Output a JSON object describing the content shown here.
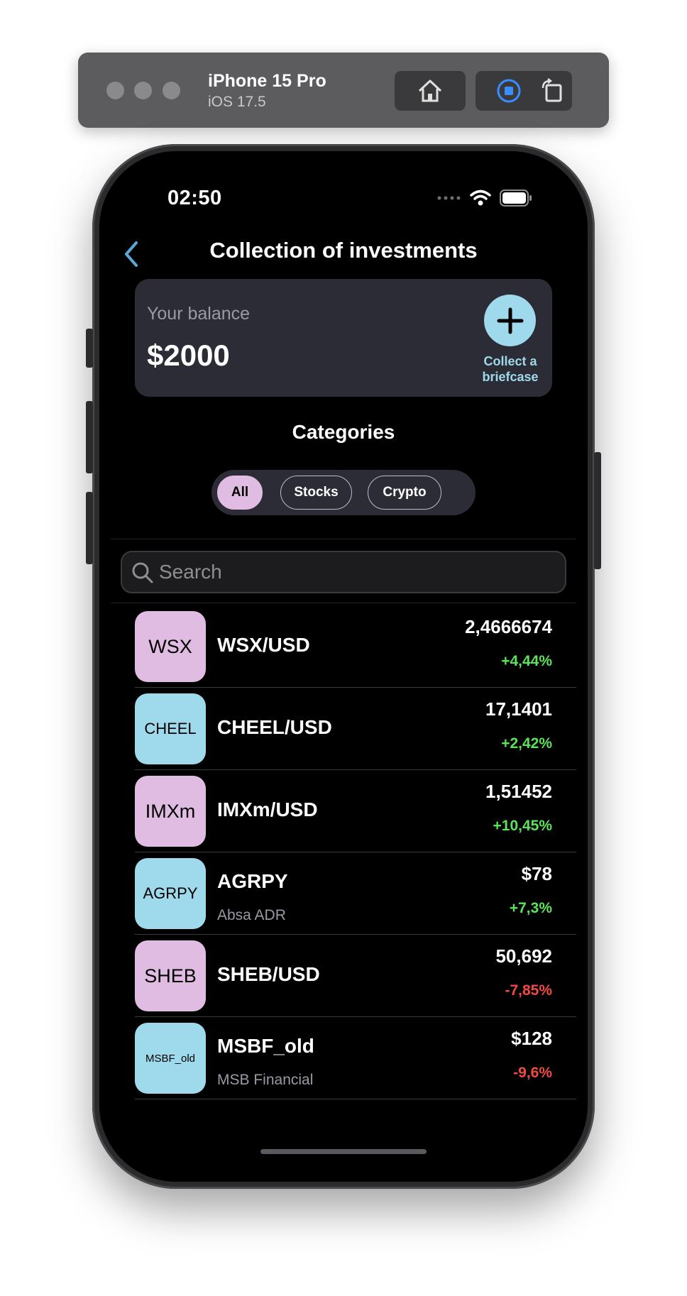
{
  "simulator": {
    "device": "iPhone 15 Pro",
    "os": "iOS 17.5",
    "buttons": [
      "home-icon",
      "record-icon",
      "rotate-icon"
    ]
  },
  "status_bar": {
    "time": "02:50"
  },
  "header": {
    "title": "Collection of investments"
  },
  "balance": {
    "label": "Your balance",
    "value": "$2000",
    "action_label_1": "Collect a",
    "action_label_2": "briefcase"
  },
  "categories": {
    "title": "Categories",
    "tabs": [
      {
        "label": "All",
        "active": true
      },
      {
        "label": "Stocks",
        "active": false
      },
      {
        "label": "Crypto",
        "active": false
      }
    ]
  },
  "search": {
    "placeholder": "Search",
    "value": ""
  },
  "assets": [
    {
      "ticker": "WSX",
      "name": "WSX/USD",
      "subtitle": "",
      "price": "2,4666674",
      "change": "+4,44%",
      "direction": "up",
      "tile_color": "pink"
    },
    {
      "ticker": "CHEEL",
      "name": "CHEEL/USD",
      "subtitle": "",
      "price": "17,1401",
      "change": "+2,42%",
      "direction": "up",
      "tile_color": "blue"
    },
    {
      "ticker": "IMXm",
      "name": "IMXm/USD",
      "subtitle": "",
      "price": "1,51452",
      "change": "+10,45%",
      "direction": "up",
      "tile_color": "pink"
    },
    {
      "ticker": "AGRPY",
      "name": "AGRPY",
      "subtitle": "Absa ADR",
      "price": "$78",
      "change": "+7,3%",
      "direction": "up",
      "tile_color": "blue"
    },
    {
      "ticker": "SHEB",
      "name": "SHEB/USD",
      "subtitle": "",
      "price": "50,692",
      "change": "-7,85%",
      "direction": "down",
      "tile_color": "pink"
    },
    {
      "ticker": "MSBF_old",
      "name": "MSBF_old",
      "subtitle": "MSB Financial",
      "price": "$128",
      "change": "-9,6%",
      "direction": "down",
      "tile_color": "blue"
    }
  ],
  "colors": {
    "accent_blue": "#9fd9ec",
    "accent_pink": "#e0bce3",
    "card_bg": "#2c2c36",
    "positive": "#5be35a",
    "negative": "#f04a42"
  }
}
